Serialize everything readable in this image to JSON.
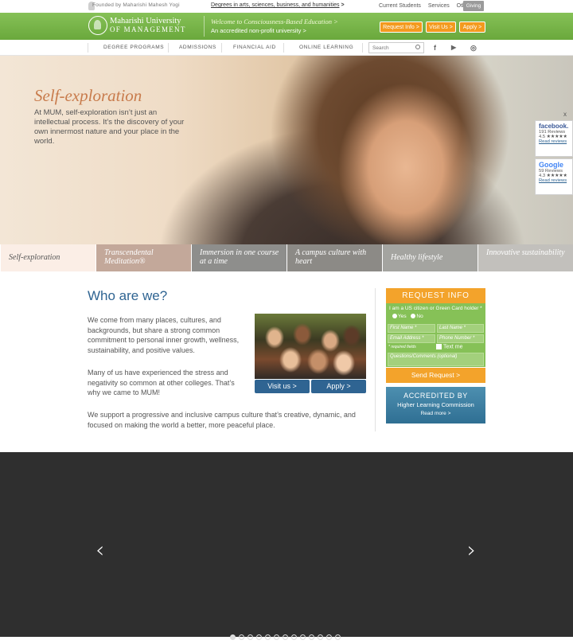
{
  "topbar": {
    "founder": "Founded by Maharishi Mahesh Yogi",
    "degrees": "Degrees in arts, sciences, business, and humanities",
    "degrees_arrow": ">",
    "links": [
      "Current Students",
      "Services",
      "Other ☰"
    ],
    "giving": "Giving"
  },
  "header": {
    "logo_line1": "Maharishi University",
    "logo_line2": "OF MANAGEMENT",
    "welcome": "Welcome to Consciousness-Based Education >",
    "accredited": "An accredited non-profit university >",
    "buttons": [
      "Request Info >",
      "Visit Us >",
      "Apply >"
    ]
  },
  "nav": {
    "items": [
      "DEGREE PROGRAMS",
      "ADMISSIONS",
      "FINANCIAL AID",
      "ONLINE LEARNING"
    ],
    "search_placeholder": "Search",
    "social": [
      "f",
      "▶",
      "◎"
    ]
  },
  "hero": {
    "title": "Self-exploration",
    "text": "At MUM, self-exploration isn’t just an intellectual process. It’s the discovery of your own innermost nature and your place in the world."
  },
  "tabs": [
    {
      "label": "Self-exploration"
    },
    {
      "label": "Transcendental Meditation®"
    },
    {
      "label": "Immersion in one course at a time"
    },
    {
      "label": "A campus culture with heart"
    },
    {
      "label": "Healthy lifestyle"
    },
    {
      "label": "Innovative sustainability"
    }
  ],
  "who": {
    "title": "Who are we?",
    "p1": "We come from many places, cultures, and backgrounds, but share a strong common commitment to personal inner growth, wellness, sustainability, and positive values.",
    "p2": "Many of us have experienced the stress and negativity so common at other colleges. That’s why we came to MUM!",
    "p3": "We support a progressive and inclusive campus culture that’s creative, dynamic, and focused on making the world a better, more peaceful place.",
    "visit": "Visit us >",
    "apply": "Apply >"
  },
  "request": {
    "heading": "REQUEST INFO",
    "question": "I am a US citizen or Green Card holder *",
    "yes": "Yes",
    "no": "No",
    "first_name": "First Name *",
    "last_name": "Last Name *",
    "email": "Email Address *",
    "phone": "Phone Number *",
    "required": "* required fields",
    "textme": "Text me",
    "comments": "Questions/Comments (optional)",
    "send": "Send Request >"
  },
  "accredited_box": {
    "line1": "ACCREDITED BY",
    "line2": "Higher Learning Commission",
    "line3": "Read more >"
  },
  "reviews": {
    "close": "x",
    "facebook": {
      "brand": "facebook.",
      "count": "191 Reviews",
      "rating": "4.5 ★★★★★",
      "link": "Read reviews"
    },
    "google": {
      "brand": "Google",
      "count": "59 Reviews",
      "rating": "4.3 ★★★★★",
      "link": "Read reviews"
    }
  },
  "slider": {
    "prev": "‹",
    "next": "›",
    "dots": 13,
    "active_dot": 0
  }
}
